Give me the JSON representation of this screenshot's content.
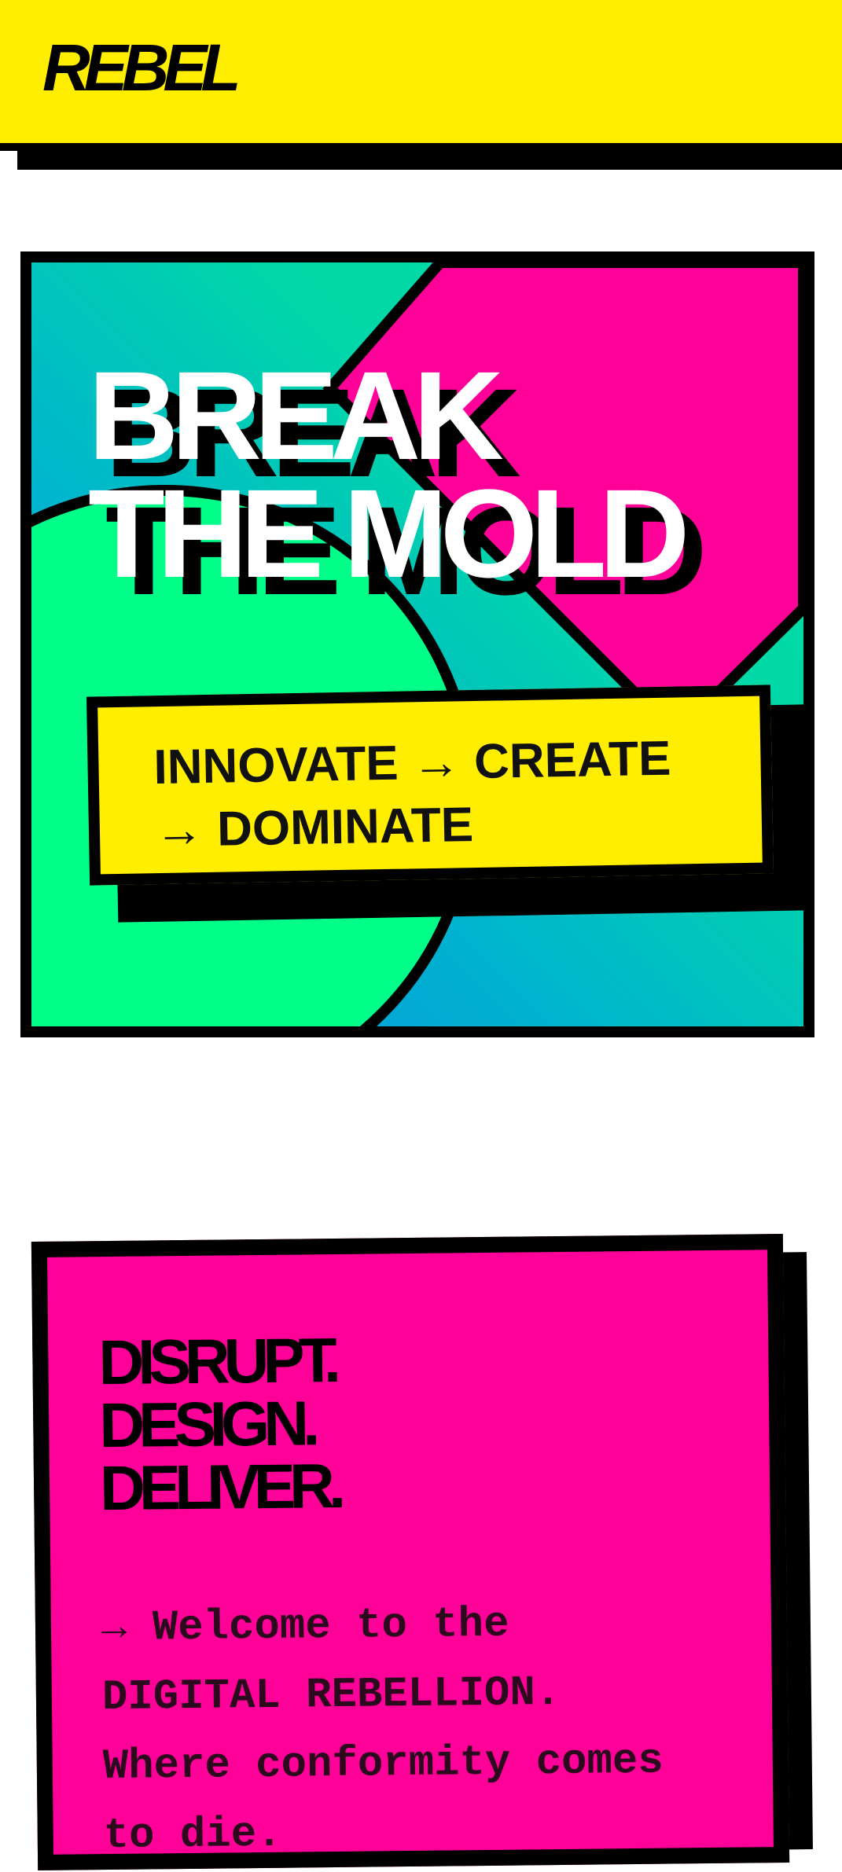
{
  "header": {
    "logo": "REBEL"
  },
  "hero": {
    "title_line1": "BREAK",
    "title_line2": "THE MOLD",
    "tagline": "INNOVATE → CREATE → DOMINATE"
  },
  "card": {
    "title_line1": "DISRUPT.",
    "title_line2": "DESIGN.",
    "title_line3": "DELIVER.",
    "body": "→ Welcome to the DIGITAL REBELLION. Where conformity comes to die."
  },
  "colors": {
    "yellow": "#FFEE00",
    "pink": "#FF0099",
    "green": "#00FF88",
    "teal": "#00CFB0",
    "blue": "#0A8EE0",
    "black": "#000000"
  }
}
